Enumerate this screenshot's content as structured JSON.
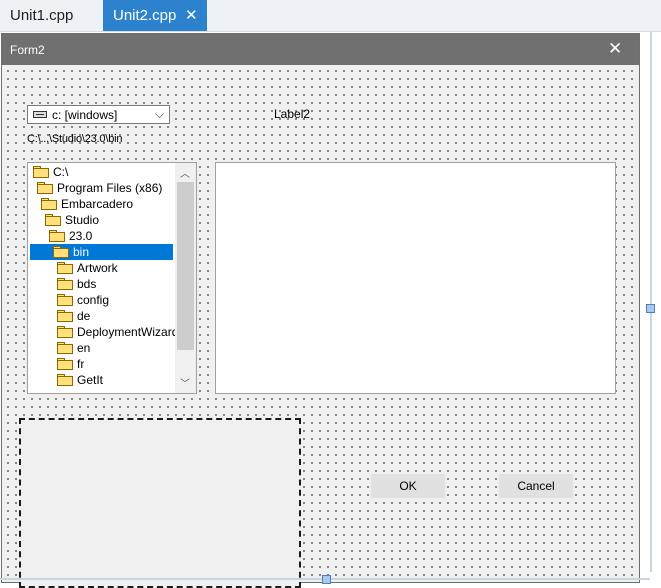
{
  "tabs": [
    {
      "label": "Unit1.cpp",
      "active": false
    },
    {
      "label": "Unit2.cpp",
      "active": true,
      "close": "✕"
    }
  ],
  "form": {
    "title": "Form2",
    "close_glyph": "✕",
    "drive_combo": {
      "value": "c: [windows]",
      "chevron": "⌵"
    },
    "label2": "Label2",
    "dir_label": "C:\\...\\Studio\\23.0\\bin",
    "directory_list": [
      {
        "label": "C:\\",
        "level": 0,
        "open": true
      },
      {
        "label": "Program Files (x86)",
        "level": 1,
        "open": true
      },
      {
        "label": "Embarcadero",
        "level": 2,
        "open": true
      },
      {
        "label": "Studio",
        "level": 3,
        "open": true
      },
      {
        "label": "23.0",
        "level": 4,
        "open": true
      },
      {
        "label": "bin",
        "level": 5,
        "open": true,
        "selected": true
      },
      {
        "label": "Artwork",
        "level": 6
      },
      {
        "label": "bds",
        "level": 6
      },
      {
        "label": "config",
        "level": 6
      },
      {
        "label": "de",
        "level": 6
      },
      {
        "label": "DeploymentWizard",
        "level": 6
      },
      {
        "label": "en",
        "level": 6
      },
      {
        "label": "fr",
        "level": 6
      },
      {
        "label": "GetIt",
        "level": 6
      }
    ],
    "buttons": {
      "ok": "OK",
      "cancel": "Cancel"
    }
  },
  "colors": {
    "caption_bg": "#707070",
    "active_tab": "#2c82cc",
    "selection": "#0078d7",
    "folder": "#ffe07a"
  }
}
